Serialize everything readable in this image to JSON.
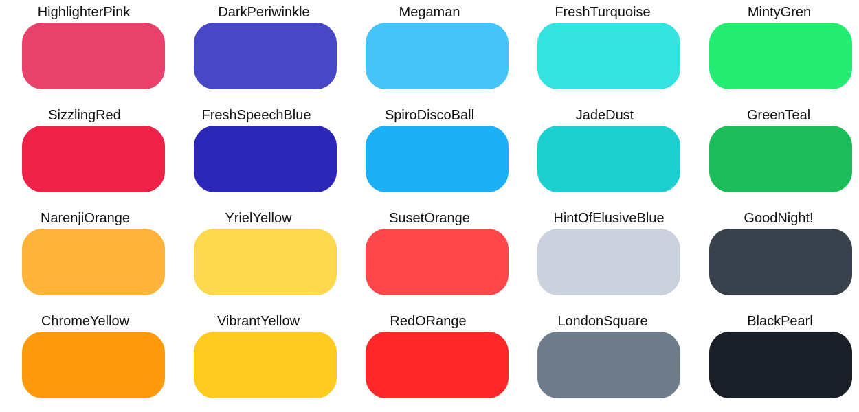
{
  "swatches": [
    {
      "name": "HighlighterPink",
      "color": "#E8416B"
    },
    {
      "name": "DarkPeriwinkle",
      "color": "#4848C6"
    },
    {
      "name": "Megaman",
      "color": "#44C4F8"
    },
    {
      "name": "FreshTurquoise",
      "color": "#34E3DF"
    },
    {
      "name": "MintyGren",
      "color": "#24EB72"
    },
    {
      "name": "SizzlingRed",
      "color": "#EE2249"
    },
    {
      "name": "FreshSpeechBlue",
      "color": "#2D27B8"
    },
    {
      "name": "SpiroDiscoBall",
      "color": "#1CB0F6"
    },
    {
      "name": "JadeDust",
      "color": "#1CD0CF"
    },
    {
      "name": "GreenTeal",
      "color": "#1CBC5A"
    },
    {
      "name": "NarenjiOrange",
      "color": "#FEB33B"
    },
    {
      "name": "YrielYellow",
      "color": "#FED84E"
    },
    {
      "name": "SusetOrange",
      "color": "#FE474B"
    },
    {
      "name": "HintOfElusiveBlue",
      "color": "#CBD2DD"
    },
    {
      "name": "GoodNight!",
      "color": "#38414C"
    },
    {
      "name": "ChromeYellow",
      "color": "#FE9A0D"
    },
    {
      "name": "VibrantYellow",
      "color": "#FFCB21"
    },
    {
      "name": "RedORange",
      "color": "#FE2828"
    },
    {
      "name": "LondonSquare",
      "color": "#6E7B88"
    },
    {
      "name": "BlackPearl",
      "color": "#1A1E27"
    }
  ]
}
